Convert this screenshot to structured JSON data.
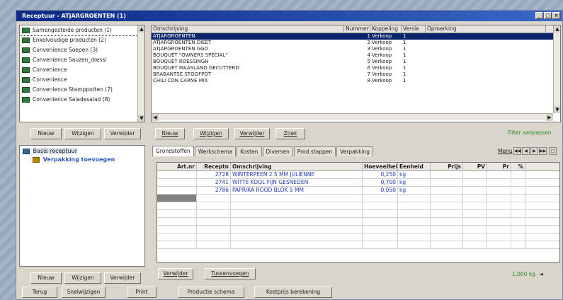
{
  "window": {
    "title": "Receptuur - ATJARGROENTEN (1)"
  },
  "categories": {
    "items": [
      "Samengestelde producten (1)",
      "Enkelvoudige producten (2)",
      "Convenience Soepen (3)",
      "Convenience Sauzen_dressi",
      "Convenience",
      "Convenience",
      "Convenience Stamppotten (7)",
      "Convenience Saladesalad (8)"
    ],
    "buttons": {
      "new": "Nieuw",
      "edit": "Wijzigen",
      "delete": "Verwijder"
    }
  },
  "recipes": {
    "columns": [
      "Omschrijving",
      "Nummer",
      "Koppeling",
      "Versie",
      "Opmerking"
    ],
    "rows": [
      {
        "name": "ATJARGROENTEN",
        "num": "1",
        "link": "Verkoop",
        "ver": "1",
        "note": ""
      },
      {
        "name": "ATJARGROENTEN DIEET",
        "num": "2",
        "link": "Verkoop",
        "ver": "1",
        "note": ""
      },
      {
        "name": "ATJARGROENTEN GGD",
        "num": "3",
        "link": "Verkoop",
        "ver": "1",
        "note": ""
      },
      {
        "name": "BOUQUET \"OWNERS SPECIAL\"",
        "num": "4",
        "link": "Verkoop",
        "ver": "1",
        "note": ""
      },
      {
        "name": "BOUQUET ROESSINGH",
        "num": "5",
        "link": "Verkoop",
        "ver": "1",
        "note": ""
      },
      {
        "name": "BOUQUET MAASLAND GECUTTERD",
        "num": "6",
        "link": "Verkoop",
        "ver": "1",
        "note": ""
      },
      {
        "name": "BRABANTSE STOOFPOT",
        "num": "7",
        "link": "Verkoop",
        "ver": "1",
        "note": ""
      },
      {
        "name": "CHILI CON CARNE MIX",
        "num": "8",
        "link": "Verkoop",
        "ver": "1",
        "note": ""
      }
    ],
    "buttons": {
      "new": "Nieuw",
      "edit": "Wijzigen",
      "delete": "Verwijder",
      "search": "Zoek"
    },
    "filter": "Filter aanpassen"
  },
  "tree": {
    "root": "Basis receptuur",
    "child": "Verpakking toevoegen",
    "buttons": {
      "new": "Nieuw",
      "edit": "Wijzigen",
      "delete": "Verwijder"
    }
  },
  "detail": {
    "tabs": [
      "Grondstoffen",
      "Werkschema",
      "Kosten",
      "Diversen",
      "Prod.stappen",
      "Verpakking"
    ],
    "menu": "Menu",
    "columns": [
      "Art.nr",
      "Receptn",
      "Omschrijving",
      "Hoeveelhei",
      "Eenheid",
      "Prijs",
      "PV",
      "Pr",
      "%"
    ],
    "rows": [
      {
        "art": "",
        "rec": "2728",
        "desc": "WINTERPEEN 2.5 MM JULIENNE",
        "qty": "0,250",
        "unit": "kg"
      },
      {
        "art": "",
        "rec": "2741",
        "desc": "WITTE KOOL FIJN GESNEDEN",
        "qty": "0,700",
        "unit": "kg"
      },
      {
        "art": "",
        "rec": "2786",
        "desc": "PAPRIKA ROOD BLOK 5 MM",
        "qty": "0,050",
        "unit": "kg"
      }
    ],
    "buttons": {
      "delete": "Verwijder",
      "insert": "Tussenvoegen"
    },
    "total": "1,000 kg"
  },
  "footer": {
    "buttons": [
      "Terug",
      "Snelwijzigen",
      "Print",
      "Productie schema",
      "Kostprijs berekening"
    ]
  }
}
